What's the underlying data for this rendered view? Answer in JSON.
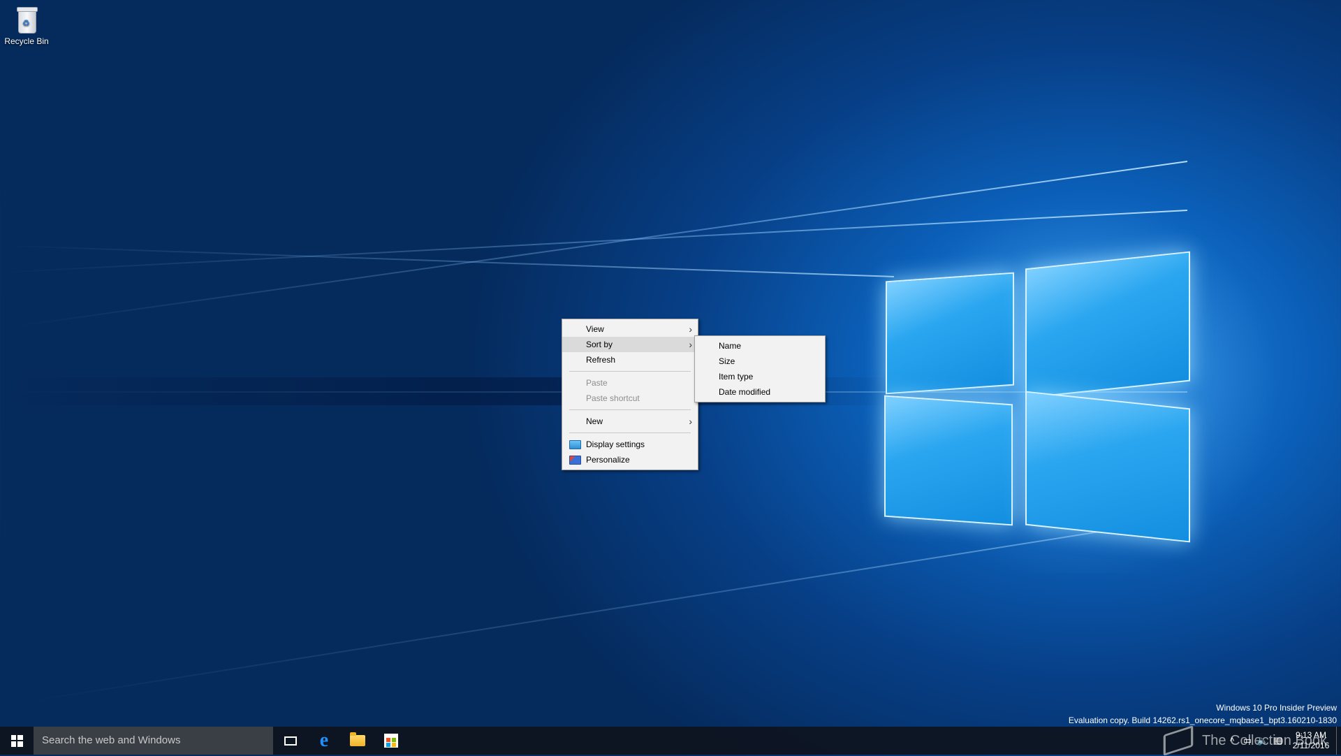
{
  "desktop": {
    "icons": [
      {
        "label": "Recycle Bin",
        "icon": "recycle-bin-icon"
      }
    ]
  },
  "context_menu": {
    "items": [
      {
        "label": "View",
        "has_submenu": true,
        "state": "normal"
      },
      {
        "label": "Sort by",
        "has_submenu": true,
        "state": "highlighted"
      },
      {
        "label": "Refresh",
        "has_submenu": false,
        "state": "normal"
      },
      {
        "label": "Paste",
        "has_submenu": false,
        "state": "disabled"
      },
      {
        "label": "Paste shortcut",
        "has_submenu": false,
        "state": "disabled"
      },
      {
        "label": "New",
        "has_submenu": true,
        "state": "normal"
      },
      {
        "label": "Display settings",
        "icon": "display-settings-icon",
        "state": "normal"
      },
      {
        "label": "Personalize",
        "icon": "personalize-icon",
        "state": "normal"
      }
    ],
    "submenu_arrow": "›"
  },
  "sort_submenu": {
    "items": [
      {
        "label": "Name"
      },
      {
        "label": "Size"
      },
      {
        "label": "Item type"
      },
      {
        "label": "Date modified"
      }
    ]
  },
  "watermark": {
    "line1": "Windows 10 Pro Insider Preview",
    "line2": "Evaluation copy. Build 14262.rs1_onecore_mqbase1_bpt3.160210-1830"
  },
  "taskbar": {
    "search_placeholder": "Search the web and Windows",
    "pinned": [
      "task-view-icon",
      "edge-icon",
      "file-explorer-icon",
      "store-icon"
    ],
    "tray": {
      "chevron": "^",
      "time": "9:13 AM",
      "date": "2/11/2016"
    }
  },
  "overlay_watermark": {
    "text": "The Collection Book"
  },
  "colors": {
    "accent": "#1e90ff",
    "menu_bg": "#f2f2f2",
    "menu_highlight": "#dadada",
    "taskbar_bg": "#0e141e"
  }
}
